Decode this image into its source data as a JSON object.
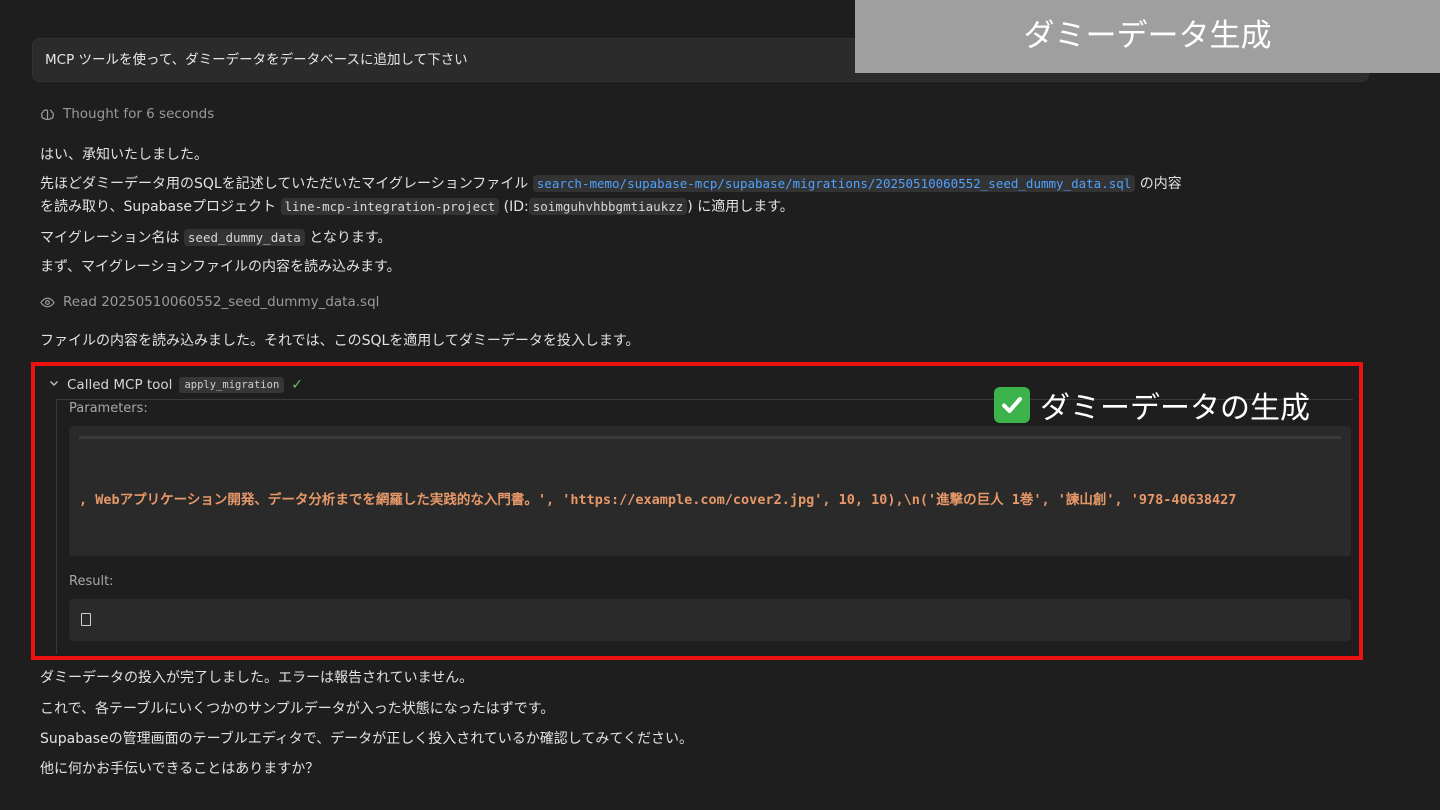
{
  "banner": {
    "title": "ダミーデータ生成"
  },
  "prompt": {
    "text": "MCP ツールを使って、ダミーデータをデータベースに追加して下さい"
  },
  "thought": {
    "text": "Thought for 6 seconds",
    "icon": "brain-icon"
  },
  "response": {
    "line1": "はい、承知いたしました。",
    "line2_a": "先ほどダミーデータ用のSQLを記述していただいたマイグレーションファイル",
    "line2_path": "search-memo/supabase-mcp/supabase/migrations/20250510060552_seed_dummy_data.sql",
    "line2_b": "の内容",
    "line3_a": "を読み取り、Supabaseプロジェクト",
    "line3_project": "line-mcp-integration-project",
    "line3_b": "(ID:",
    "line3_id": "soimguhvhbbgmtiaukzz",
    "line3_c": ") に適用します。",
    "line4_a": "マイグレーション名は",
    "line4_name": "seed_dummy_data",
    "line4_b": "となります。",
    "line5": "まず、マイグレーションファイルの内容を読み込みます。"
  },
  "read": {
    "text": "Read 20250510060552_seed_dummy_data.sql",
    "icon": "eye-icon"
  },
  "after_read": "ファイルの内容を読み込みました。それでは、このSQLを適用してダミーデータを投入します。",
  "tool": {
    "title": "Called MCP tool",
    "name": "apply_migration",
    "status_icon": "checkmark-icon",
    "params_label": "Parameters:",
    "params_text": ", Webアプリケーション開発、データ分析までを網羅した実践的な入門書。', 'https://example.com/cover2.jpg', 10, 10),\\n('進撃の巨人 1巻', '諫山創', '978-40638427",
    "result_label": "Result:",
    "result_text": "[]"
  },
  "overlay": {
    "text": "ダミーデータの生成",
    "icon": "green-check-emoji"
  },
  "footer": {
    "line1": "ダミーデータの投入が完了しました。エラーは報告されていません。",
    "line2": "これで、各テーブルにいくつかのサンプルデータが入った状態になったはずです。",
    "line3": "Supabaseの管理画面のテーブルエディタで、データが正しく投入されているか確認してみてください。",
    "line4": "他に何かお手伝いできることはありますか？"
  },
  "colors": {
    "background": "#1e1e1e",
    "highlight_frame": "#ee1111",
    "banner_bg": "#9f9f9f",
    "link": "#4ea1ff",
    "code_string": "#e79868"
  }
}
